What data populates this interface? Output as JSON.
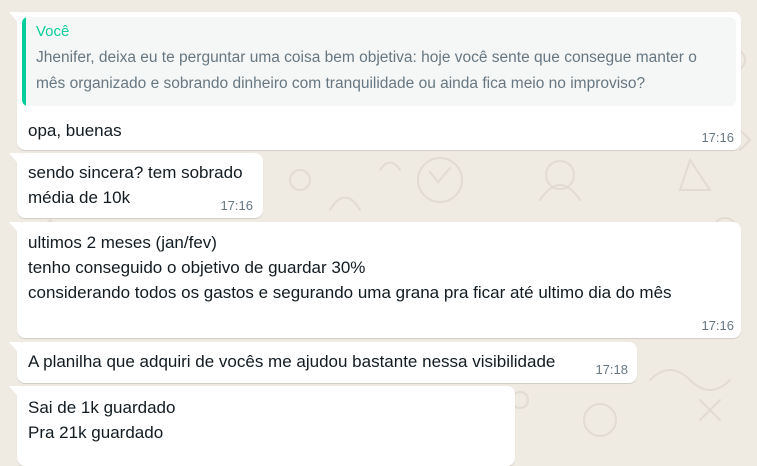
{
  "quoted": {
    "author": "Você",
    "text": "Jhenifer, deixa eu te perguntar uma coisa bem objetiva: hoje você sente que consegue manter o mês organizado e sobrando dinheiro com tranquilidade ou ainda fica meio no improviso?"
  },
  "messages": [
    {
      "lines": [
        "opa, buenas"
      ],
      "time": "17:16"
    },
    {
      "lines": [
        "sendo sincera? tem sobrado",
        "média de 10k"
      ],
      "time": "17:16"
    },
    {
      "lines": [
        "ultimos 2 meses (jan/fev)",
        "tenho conseguido o objetivo de guardar 30%",
        "considerando todos os gastos e segurando uma grana pra ficar até ultimo dia do mês"
      ],
      "time": "17:16"
    },
    {
      "lines": [
        "A planilha que adquiri de vocês me ajudou bastante nessa visibilidade"
      ],
      "time": "17:18"
    },
    {
      "lines": [
        "Sai de 1k guardado",
        "Pra 21k guardado"
      ],
      "time": ""
    }
  ],
  "colors": {
    "background": "#efeae2",
    "bubble": "#ffffff",
    "quote_accent": "#06cf9c",
    "timestamp": "#667781"
  }
}
